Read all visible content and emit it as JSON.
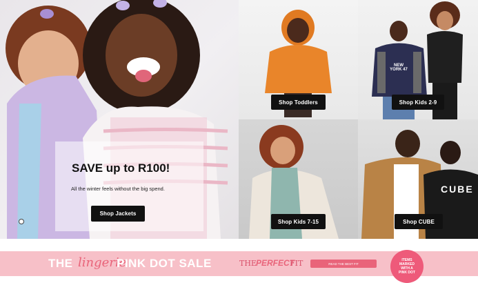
{
  "hero": {
    "title": "SAVE up to R100!",
    "subtitle": "All the winter feels without the big spend.",
    "cta": "Shop Jackets"
  },
  "tiles": [
    {
      "cta": "Shop Toddlers"
    },
    {
      "cta": "Shop Kids 2-9",
      "shirt_text": "NEW YORK 47"
    },
    {
      "cta": "Shop Kids 7-15"
    },
    {
      "cta": "Shop CUBE",
      "shirt_text": "CUBE"
    }
  ],
  "banner": {
    "the": "THE",
    "lingerie": "lingerie",
    "pink_dot_sale": "PINK DOT SALE",
    "the_perfect": "THE",
    "perfect": "PERFECT",
    "fit": "FIT",
    "pill_text": "READ THE BEST FIT",
    "circle_lines": [
      "ITEMS",
      "MARKED",
      "WITH A",
      "PINK DOT"
    ]
  },
  "colors": {
    "button_bg": "#111111",
    "banner_bg": "#f7c0c8",
    "accent_pink": "#e9647a"
  }
}
